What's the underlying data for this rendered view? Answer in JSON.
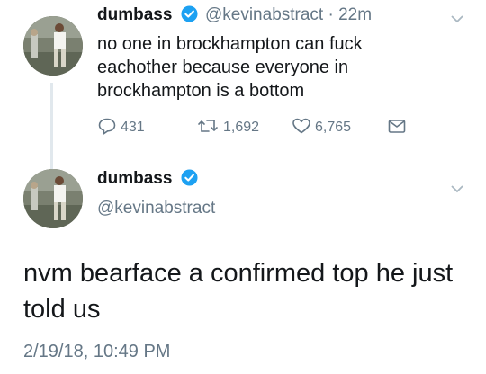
{
  "tweet1": {
    "display_name": "dumbass",
    "handle": "@kevinabstract",
    "separator": "·",
    "time": "22m",
    "text_lines": [
      "no one in brockhampton can fuck",
      "eachother because everyone in",
      "brockhampton is a bottom"
    ],
    "reply_count": "431",
    "retweet_count": "1,692",
    "like_count": "6,765"
  },
  "tweet2": {
    "display_name": "dumbass",
    "handle": "@kevinabstract",
    "text_lines": [
      "nvm bearface a confirmed top he just",
      "told us"
    ],
    "timestamp": "2/19/18, 10:49 PM"
  },
  "icons": {
    "verified": "verified-badge-icon",
    "menu": "chevron-down-icon",
    "reply": "reply-icon",
    "retweet": "retweet-icon",
    "like": "heart-icon",
    "dm": "envelope-icon"
  },
  "colors": {
    "text": "#14171a",
    "secondary": "#657786",
    "verified": "#1da1f2",
    "thread_line": "#e1e8ed"
  }
}
